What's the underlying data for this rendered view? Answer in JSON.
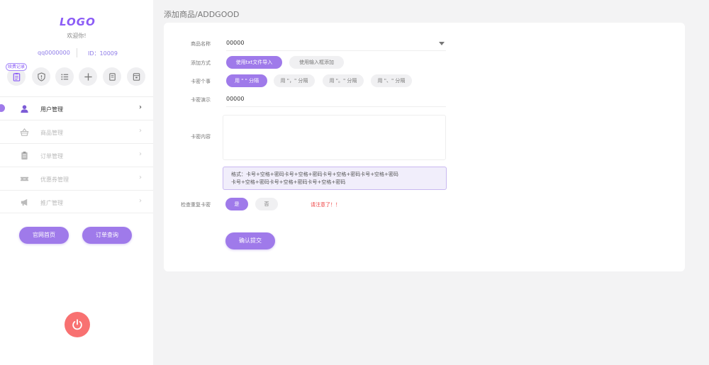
{
  "sidebar": {
    "logo": "LOGO",
    "welcome": "欢迎你!",
    "account": "qq0000000",
    "user_id": "ID：10009",
    "quick_badge": "续费记录",
    "quick_icons": [
      "clipboard-icon",
      "shield-alert-icon",
      "list-icon",
      "plus-icon",
      "document-icon",
      "archive-icon"
    ],
    "menu": [
      {
        "label": "用户管理",
        "icon": "user-icon",
        "active": true
      },
      {
        "label": "商品管理",
        "icon": "basket-icon",
        "active": false
      },
      {
        "label": "订单管理",
        "icon": "clipboard-icon",
        "active": false
      },
      {
        "label": "优惠券管理",
        "icon": "ticket-icon",
        "active": false
      },
      {
        "label": "推广管理",
        "icon": "megaphone-icon",
        "active": false
      }
    ],
    "arrow": "›",
    "btn_home": "官网首页",
    "btn_order": "订单查询"
  },
  "page": {
    "title": "添加商品/ADDGOOD"
  },
  "form": {
    "product_name_label": "商品名称",
    "product_name_value": "00000",
    "method_label": "添加方式",
    "method_options": [
      "使用txt文件导入",
      "使用输入框添加"
    ],
    "per_card_label": "卡密个事",
    "per_card_options": [
      "用 \" \" 分隔",
      "用 \"，\" 分隔",
      "用 \"。\" 分隔",
      "用 \"、\" 分隔"
    ],
    "demo_label": "卡密演示",
    "demo_value": "00000",
    "content_label": "卡密内容",
    "hint_line1": "格式：卡号+空格+密码卡号+空格+密码卡号+空格+密码卡号+空格+密码",
    "hint_line2": "卡号+空格+密码卡号+空格+密码卡号+空格+密码",
    "dup_label": "检查重复卡密",
    "dup_yes": "是",
    "dup_no": "否",
    "warning": "请注意了！！",
    "submit": "确认提交"
  },
  "colors": {
    "accent": "#9f7aea",
    "danger": "#f87171"
  }
}
